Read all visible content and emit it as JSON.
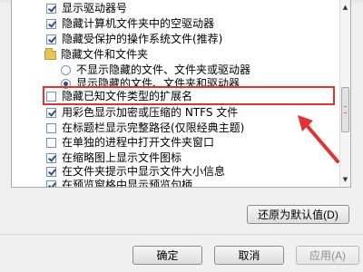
{
  "advanced_settings": {
    "items": [
      {
        "type": "checkbox",
        "checked": true,
        "label": "显示驱动器号"
      },
      {
        "type": "checkbox",
        "checked": true,
        "label": "隐藏计算机文件夹中的空驱动器"
      },
      {
        "type": "checkbox",
        "checked": true,
        "label": "隐藏受保护的操作系统文件(推荐)"
      },
      {
        "type": "folder",
        "label": "隐藏文件和文件夹"
      },
      {
        "type": "radio",
        "selected": false,
        "label": "不显示隐藏的文件、文件夹或驱动器"
      },
      {
        "type": "radio",
        "selected": true,
        "label": "显示隐藏的文件、文件夹和驱动器"
      },
      {
        "type": "checkbox",
        "checked": false,
        "label": "隐藏已知文件类型的扩展名"
      },
      {
        "type": "checkbox",
        "checked": true,
        "label": "用彩色显示加密或压缩的 NTFS 文件"
      },
      {
        "type": "checkbox",
        "checked": false,
        "label": "在标题栏显示完整路径(仅限经典主题)"
      },
      {
        "type": "checkbox",
        "checked": false,
        "label": "在单独的进程中打开文件夹窗口"
      },
      {
        "type": "checkbox",
        "checked": true,
        "label": "在缩略图上显示文件图标"
      },
      {
        "type": "checkbox",
        "checked": true,
        "label": "在文件夹提示中显示文件大小信息"
      },
      {
        "type": "checkbox",
        "checked": true,
        "label": "在预览窗格中显示预览句柄"
      }
    ]
  },
  "buttons": {
    "restore_defaults": "还原为默认值(D)",
    "ok": "确定",
    "cancel": "取消",
    "apply": "应用(A)"
  },
  "colors": {
    "annotation_red": "#e53030",
    "pane_border": "#a9a9a9"
  }
}
